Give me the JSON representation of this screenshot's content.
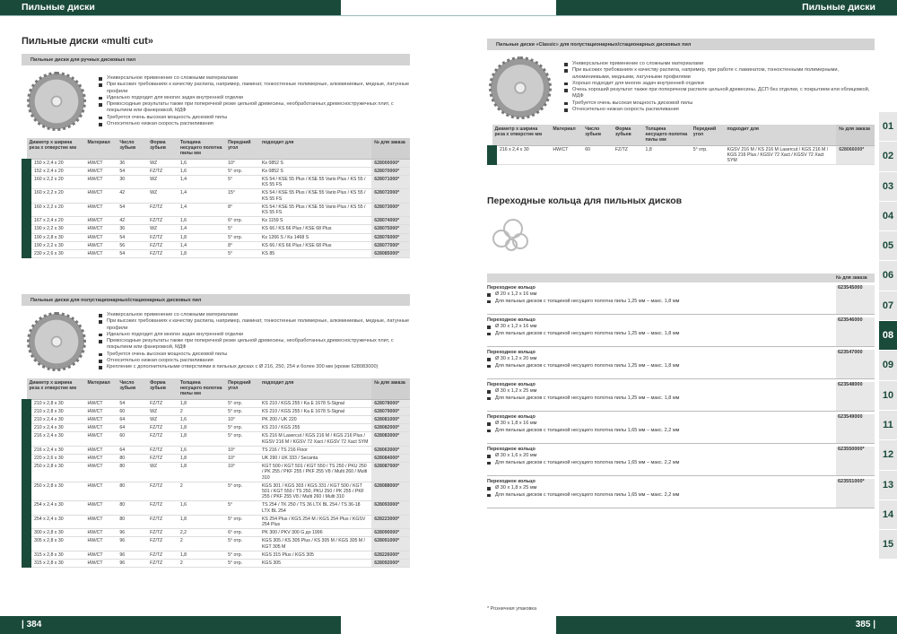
{
  "header": {
    "left_title": "Пильные диски",
    "right_title": "Пильные диски"
  },
  "footer": {
    "left_page": "| 384",
    "right_page": "385 |"
  },
  "left": {
    "title": "Пильные диски «multi cut»",
    "s1": {
      "heading": "Пильные диски для ручных дисковых пил",
      "features": [
        "Универсальное применение со сложными материалами",
        "При высоких требованиях к качеству распила, например, ламинат, тонкостенные полимерные, алюминиевые, медные, латунные профили",
        "Идеально подходит для многих задач внутренней отделки",
        "Превосходные результаты также при поперечной резке цельной древесины, необработанных древесностружечных плит, с покрытием или фанеровкой, МДФ",
        "Требуется очень высокая мощность дисковой пилы",
        "Относительно низкая скорость распиливания"
      ],
      "columns": [
        "Диаметр x ширина реза x отверстие мм",
        "Материал",
        "Число зубьев",
        "Форма зубьев",
        "Толщина несущего полотна пилы мм",
        "Передний угол",
        "подходит для",
        "№ для заказа"
      ],
      "rows": [
        [
          "150 x 2,4 x 20",
          "HW/CT",
          "36",
          "WZ",
          "1,6",
          "10°",
          "Ks 0852 S",
          "628000000*"
        ],
        [
          "152 x 2,4 x 20",
          "HW/CT",
          "54",
          "FZ/TZ",
          "1,6",
          "5° отр.",
          "Ks 0852 S",
          "628070000*"
        ],
        [
          "160 x 2,2 x 20",
          "HW/CT",
          "30",
          "WZ",
          "1,4",
          "5°",
          "KS 54 / KSE 55 Plus / KSE 55 Vario Plus / KS 55 / KS 55 FS",
          "628071000*"
        ],
        [
          "160 x 2,2 x 20",
          "HW/CT",
          "42",
          "WZ",
          "1,4",
          "15°",
          "KS 54 / KSE 55 Plus / KSE 55 Vario Plus / KS 55 / KS 55 FS",
          "628072000*"
        ],
        [
          "160 x 2,2 x 20",
          "HW/CT",
          "54",
          "FZ/TZ",
          "1,4",
          "8°",
          "KS 54 / KSE 55 Plus / KSE 55 Vario Plus / KS 55 / KS 55 FS",
          "628073000*"
        ],
        [
          "167 x 2,4 x 20",
          "HW/CT",
          "42",
          "FZ/TZ",
          "1,6",
          "6° отр.",
          "Ks 1159 S",
          "628074000*"
        ],
        [
          "190 x 2,2 x 30",
          "HW/CT",
          "36",
          "WZ",
          "1,4",
          "5°",
          "KS 66 / KS 66 Plus / KSE 68 Plus",
          "628075000*"
        ],
        [
          "190 x 2,8 x 30",
          "HW/CT",
          "54",
          "FZ/TZ",
          "1,8",
          "5° отр.",
          "Ks 1266 S / Ks 1468 S",
          "628076000*"
        ],
        [
          "190 x 2,2 x 30",
          "HW/CT",
          "56",
          "FZ/TZ",
          "1,4",
          "8°",
          "KS 66 / KS 66 Plus / KSE 68 Plus",
          "628077000*"
        ],
        [
          "230 x 2,6 x 30",
          "HW/CT",
          "54",
          "FZ/TZ",
          "1,8",
          "5°",
          "KS 85",
          "628085000*"
        ]
      ]
    },
    "s2": {
      "heading": "Пильные диски для полустационарных/стационарных дисковых пил",
      "features": [
        "Универсальное применение со сложными материалами",
        "При высоких требованиях к качеству распила, например, ламинат, тонкостенные полимерные, алюминиевые, медные, латунные профили",
        "Идеально подходит для многих задач внутренней отделки",
        "Превосходные результаты также при поперечной резке цельной древесины, необработанных древесностружечных плит, с покрытием или фанеровкой, МДФ",
        "Требуется очень высокая мощность дисковой пилы",
        "Относительно низкая скорость распиливания",
        "Крепление с дополнительными отверстиями в пильных дисках с Ø 216, 250, 254 и более 300 мм (кроме 628083000)"
      ],
      "columns": [
        "Диаметр x ширина реза x отверстие мм",
        "Материал",
        "Число зубьев",
        "Форма зубьев",
        "Толщина несущего полотна пилы мм",
        "Передний угол",
        "подходит для",
        "№ для заказа"
      ],
      "rows": [
        [
          "210 x 2,8 x 30",
          "HW/CT",
          "54",
          "FZ/TZ",
          "1,8",
          "5° отр.",
          "KS 210 / KGS 255 / Ka E 1678 S-Signal",
          "628078000*"
        ],
        [
          "210 x 2,8 x 30",
          "HW/CT",
          "60",
          "WZ",
          "2",
          "5° отр.",
          "KS 210 / KGS 255 / Ka E 1678 S-Signal",
          "628079000*"
        ],
        [
          "210 x 2,4 x 30",
          "HW/CT",
          "64",
          "WZ",
          "1,6",
          "10°",
          "PK 200 / UK 220",
          "628081000*"
        ],
        [
          "210 x 2,4 x 30",
          "HW/CT",
          "64",
          "FZ/TZ",
          "1,8",
          "5° отр.",
          "KS 210 / KGS 255",
          "628082000*"
        ],
        [
          "216 x 2,4 x 30",
          "HW/CT",
          "60",
          "FZ/TZ",
          "1,8",
          "5° отр.",
          "KS 216 M Lasercut / KGS 216 M / KGS 216 Plus / KGSV 216 M / KGSV 72 Xact / KGSV 72 Xact SYM",
          "628083000*"
        ],
        [
          "216 x 2,4 x 30",
          "HW/CT",
          "64",
          "FZ/TZ",
          "1,6",
          "10°",
          "TS 216 / TS 216 Floor",
          "628063000*"
        ],
        [
          "220 x 2,6 x 30",
          "HW/CT",
          "80",
          "FZ/TZ",
          "1,8",
          "10°",
          "UK 290 / UK 333 / Secanta",
          "628084000*"
        ],
        [
          "250 x 2,8 x 30",
          "HW/CT",
          "80",
          "WZ",
          "1,8",
          "10°",
          "KGT 500 / KGT 501 / KGT 550 / TS 250 / PKU 250 / PK 255 / PKF 255 / PKF 255 V8 / Multi 260 / Multi 310",
          "628087000*"
        ],
        [
          "250 x 2,8 x 30",
          "HW/CT",
          "80",
          "FZ/TZ",
          "2",
          "5° отр.",
          "KGS 301 / KGS 303 / KGS 331 / KGT 500 / KGT 501 / KGT 550 / TS 250, PKU 250 / PK 255 / PKF 255 / PKF 255 V8 / Multi 260 / Multi 310",
          "628088000*"
        ],
        [
          "254 x 2,4 x 30",
          "HW/CT",
          "80",
          "FZ/TZ",
          "1,6",
          "5°",
          "TS 254 / TK 250 / TS 36 LTX BL 254 / TS 36-18 LTX BL 254",
          "628093000*"
        ],
        [
          "254 x 2,4 x 30",
          "HW/CT",
          "80",
          "FZ/TZ",
          "1,8",
          "5° отр.",
          "KS 254 Plus / KGS 254 M / KGS 254 Plus / KGSV 254 Plus",
          "628223000*"
        ],
        [
          "300 x 2,8 x 30",
          "HW/CT",
          "96",
          "FZ/TZ",
          "2,2",
          "6° отр.",
          "PK 300 / PKV 300 G до 1996",
          "628090000*"
        ],
        [
          "305 x 2,8 x 30",
          "HW/CT",
          "96",
          "FZ/TZ",
          "2",
          "5° отр.",
          "KGS 305 / KS 305 Plus / KS 305 M / KGS 305 M / KGT 305 M",
          "628091000*"
        ],
        [
          "315 x 2,8 x 30",
          "HW/CT",
          "96",
          "FZ/TZ",
          "1,8",
          "5° отр.",
          "KGS 315 Plus / KGS 305",
          "628226000*"
        ],
        [
          "315 x 2,8 x 30",
          "HW/CT",
          "96",
          "FZ/TZ",
          "2",
          "5° отр.",
          "KGS 305",
          "628092000*"
        ]
      ]
    }
  },
  "right": {
    "classic": {
      "heading": "Пильные диски «Classic» для полустационарных/стационарных дисковых пил",
      "features": [
        "Универсальное применение со сложными материалами",
        "При высоких требованиях к качеству распила, например, при работе с ламинатом, тонкостенными полимерными, алюминиевыми, медными, латунными профилями",
        "Хорошо подходит для многих задач внутренней отделки",
        "Очень хороший результат также при поперечном распиле цельной древесины, ДСП без отделки, с покрытием или облицовкой, МДФ",
        "Требуется очень высокая мощность дисковой пилы",
        "Относительно низкая скорость распиливания"
      ],
      "columns": [
        "Диаметр x ширина реза x отверстие мм",
        "Материал",
        "Число зубьев",
        "Форма зубьев",
        "Толщина несущего полотна пилы мм",
        "Передний угол",
        "подходит для",
        "№ для заказа"
      ],
      "rows": [
        [
          "216 x 2,4 x 30",
          "HW/CT",
          "60",
          "FZ/TZ",
          "1,8",
          "5° отр.",
          "KGSV 216 M / KS 216 M Lasercut / KGS 216 M / KGS 216 Plus / KGSV 72 Xact / KGSV 72 Xact SYM",
          "628066000*"
        ]
      ]
    },
    "rings_title": "Переходные кольца для пильных дисков",
    "rings_col": "№ для заказа",
    "rings": [
      {
        "name": "Переходное кольцо",
        "size": "Ø 20 x 1,2 x 16 мм",
        "desc": "Для пильных дисков с толщиной несущего полотна пилы 1,25 мм – макс. 1,8 мм",
        "order": "623545000"
      },
      {
        "name": "Переходное кольцо",
        "size": "Ø 30 x 1,2 x 16 мм",
        "desc": "Для пильных дисков с толщиной несущего полотна пилы 1,25 мм – макс. 1,8 мм",
        "order": "623546000"
      },
      {
        "name": "Переходное кольцо",
        "size": "Ø 30 x 1,2 x 20 мм",
        "desc": "Для пильных дисков с толщиной несущего полотна пилы 1,25 мм – макс. 1,8 мм",
        "order": "623547000"
      },
      {
        "name": "Переходное кольцо",
        "size": "Ø 30 x 1,2 x 25 мм",
        "desc": "Для пильных дисков с толщиной несущего полотна пилы 1,25 мм – макс. 1,8 мм",
        "order": "623548000"
      },
      {
        "name": "Переходное кольцо",
        "size": "Ø 30 x 1,8 x 16 мм",
        "desc": "Для пильных дисков с толщиной несущего полотна пилы 1,65 мм – макс. 2,2 мм",
        "order": "623549000"
      },
      {
        "name": "Переходное кольцо",
        "size": "Ø 30 x 1,6 x 20 мм",
        "desc": "Для пильных дисков с толщиной несущего полотна пилы 1,65 мм – макс. 2,2 мм",
        "order": "623550000*"
      },
      {
        "name": "Переходное кольцо",
        "size": "Ø 30 x 1,8 x 25 мм",
        "desc": "Для пильных дисков с толщиной несущего полотна пилы 1,65 мм – макс. 2,2 мм",
        "order": "623551000*"
      }
    ],
    "note": "* Розничная упаковка"
  },
  "tabs": [
    "01",
    "02",
    "03",
    "04",
    "05",
    "06",
    "07",
    "08",
    "09",
    "10",
    "11",
    "12",
    "13",
    "14",
    "15"
  ],
  "active_tab": "08"
}
